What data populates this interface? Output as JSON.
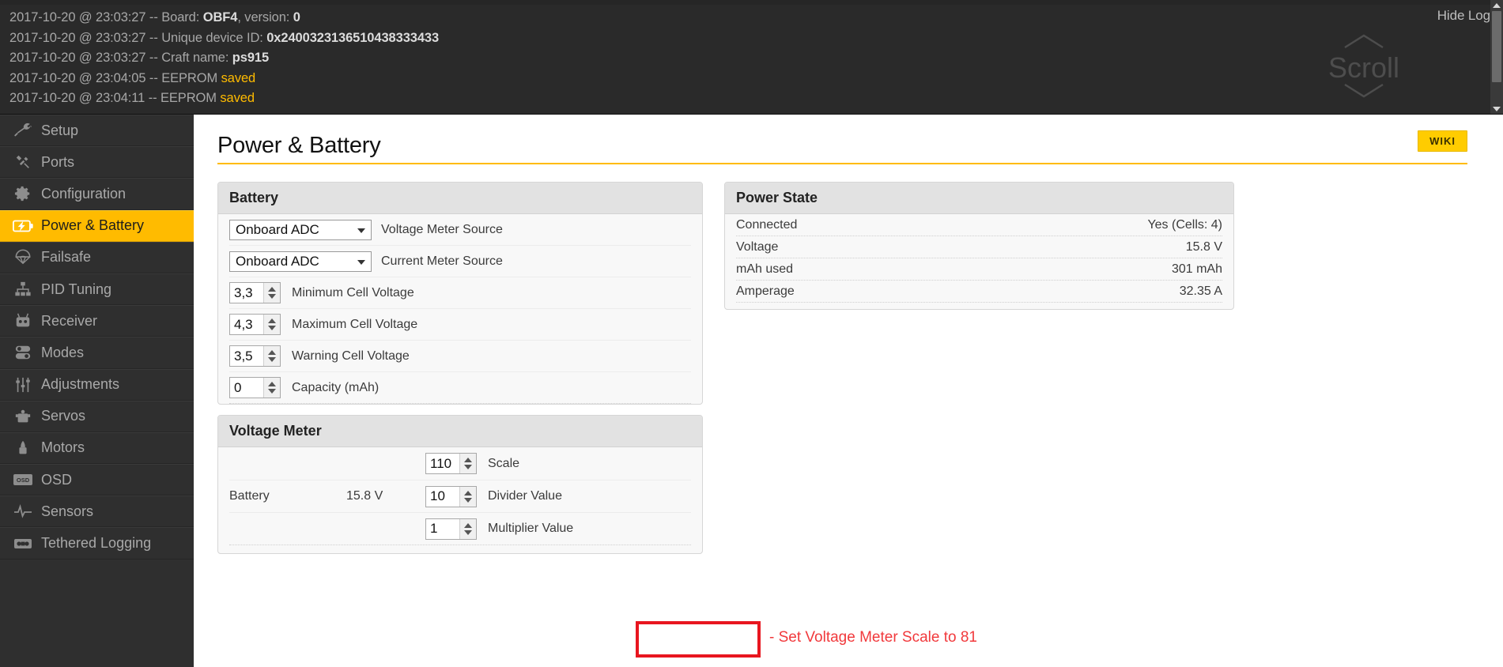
{
  "log": {
    "hide_label": "Hide Log",
    "scroll_label": "Scroll",
    "lines": [
      {
        "time": "2017-10-20 @ 23:03:27",
        "text": " -- Board: ",
        "bold": "OBF4",
        "text2": ", version: ",
        "bold2": "0"
      },
      {
        "time": "2017-10-20 @ 23:03:27",
        "text": " -- Unique device ID: ",
        "bold": "0x2400323136510438333433",
        "text2": "",
        "bold2": ""
      },
      {
        "time": "2017-10-20 @ 23:03:27",
        "text": " -- Craft name: ",
        "bold": "ps915",
        "text2": "",
        "bold2": ""
      },
      {
        "time": "2017-10-20 @ 23:04:05",
        "text": " -- EEPROM ",
        "saved": "saved"
      },
      {
        "time": "2017-10-20 @ 23:04:11",
        "text": " -- EEPROM ",
        "saved": "saved"
      }
    ]
  },
  "sidebar": {
    "items": [
      {
        "label": "Setup",
        "icon": "wrench-icon",
        "active": false
      },
      {
        "label": "Ports",
        "icon": "plug-icon",
        "active": false
      },
      {
        "label": "Configuration",
        "icon": "gear-icon",
        "active": false
      },
      {
        "label": "Power & Battery",
        "icon": "battery-icon",
        "active": true
      },
      {
        "label": "Failsafe",
        "icon": "parachute-icon",
        "active": false
      },
      {
        "label": "PID Tuning",
        "icon": "sitemap-icon",
        "active": false
      },
      {
        "label": "Receiver",
        "icon": "transmitter-icon",
        "active": false
      },
      {
        "label": "Modes",
        "icon": "toggle-icon",
        "active": false
      },
      {
        "label": "Adjustments",
        "icon": "sliders-icon",
        "active": false
      },
      {
        "label": "Servos",
        "icon": "servo-icon",
        "active": false
      },
      {
        "label": "Motors",
        "icon": "motor-icon",
        "active": false
      },
      {
        "label": "OSD",
        "icon": "osd-icon",
        "active": false
      },
      {
        "label": "Sensors",
        "icon": "pulse-icon",
        "active": false
      },
      {
        "label": "Tethered Logging",
        "icon": "logging-icon",
        "active": false
      }
    ]
  },
  "page": {
    "title": "Power & Battery",
    "wiki_label": "WIKI",
    "accent_color": "#ffbb00"
  },
  "battery_panel": {
    "title": "Battery",
    "voltage_meter_source": {
      "value": "Onboard ADC",
      "label": "Voltage Meter Source"
    },
    "current_meter_source": {
      "value": "Onboard ADC",
      "label": "Current Meter Source"
    },
    "fields": [
      {
        "value": "3,3",
        "label": "Minimum Cell Voltage"
      },
      {
        "value": "4,3",
        "label": "Maximum Cell Voltage"
      },
      {
        "value": "3,5",
        "label": "Warning Cell Voltage"
      },
      {
        "value": "0",
        "label": "Capacity (mAh)"
      }
    ]
  },
  "power_state_panel": {
    "title": "Power State",
    "rows": [
      {
        "label": "Connected",
        "value": "Yes (Cells: 4)"
      },
      {
        "label": "Voltage",
        "value": "15.8 V"
      },
      {
        "label": "mAh used",
        "value": "301 mAh"
      },
      {
        "label": "Amperage",
        "value": "32.35 A"
      }
    ]
  },
  "voltage_meter_panel": {
    "title": "Voltage Meter",
    "meter_name": "Battery",
    "meter_value": "15.8 V",
    "rows": [
      {
        "value": "110",
        "label": "Scale"
      },
      {
        "value": "10",
        "label": "Divider Value"
      },
      {
        "value": "1",
        "label": "Multiplier Value"
      }
    ],
    "annotation": "- Set Voltage Meter Scale to 81",
    "annotation_color": "#f1393c"
  }
}
